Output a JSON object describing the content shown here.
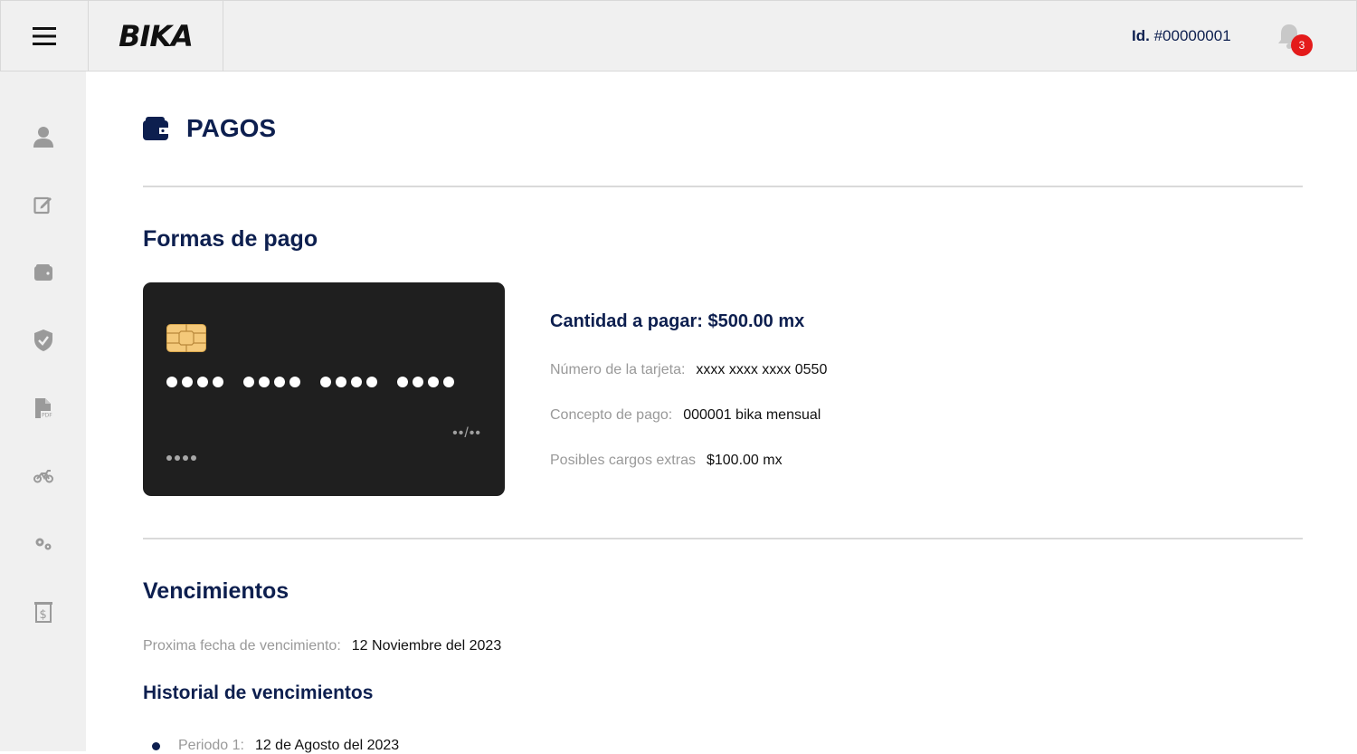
{
  "header": {
    "logo": "BIKA",
    "id_label": "Id.",
    "id_value": "#00000001",
    "notification_count": "3"
  },
  "sidebar": {
    "items": [
      {
        "icon": "user-icon"
      },
      {
        "icon": "edit-icon"
      },
      {
        "icon": "wallet-icon"
      },
      {
        "icon": "shield-check-icon"
      },
      {
        "icon": "pdf-icon"
      },
      {
        "icon": "motorcycle-icon"
      },
      {
        "icon": "gears-icon"
      },
      {
        "icon": "receipt-dollar-icon"
      }
    ]
  },
  "page": {
    "title": "PAGOS",
    "title_icon": "wallet-icon"
  },
  "payment_methods": {
    "heading": "Formas de pago",
    "card": {
      "expiry_mask": "••/••"
    },
    "amount": "Cantidad a pagar: $500.00 mx",
    "rows": [
      {
        "label": "Número de la tarjeta:",
        "value": "xxxx xxxx xxxx 0550"
      },
      {
        "label": "Concepto de pago:",
        "value": "000001 bika mensual"
      },
      {
        "label": "Posibles cargos extras",
        "value": "$100.00 mx"
      }
    ]
  },
  "due_dates": {
    "heading": "Vencimientos",
    "next_label": "Proxima fecha de vencimiento:",
    "next_value": "12 Noviembre del 2023",
    "history_heading": "Historial de vencimientos",
    "history": [
      {
        "label": "Periodo 1:",
        "value": "12 de Agosto del 2023"
      }
    ]
  },
  "colors": {
    "primary": "#0d1f4f",
    "badge": "#e41b1b",
    "card_bg": "#1f1f1f"
  }
}
